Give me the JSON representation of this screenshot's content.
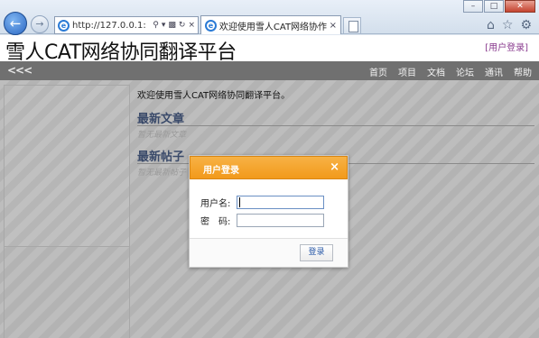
{
  "browser": {
    "window_buttons": {
      "minimize": "–",
      "maximize": "□",
      "close": "✕"
    },
    "address": "http://127.0.0.1:",
    "tab_title": "欢迎使用雪人CAT网络协作...",
    "tab_close": "×",
    "icons": [
      "back-arrow-icon",
      "forward-arrow-icon",
      "ie-logo-icon",
      "search-icon",
      "compat-icon",
      "refresh-icon",
      "stop-icon",
      "new-tab-icon",
      "home-icon",
      "favorites-star-icon",
      "settings-gear-icon"
    ]
  },
  "site": {
    "title": "雪人CAT网络协同翻译平台",
    "login_link": "[用户登录]",
    "nav_collapse": "<<<",
    "nav": [
      "首页",
      "项目",
      "文档",
      "论坛",
      "通讯",
      "帮助"
    ]
  },
  "content": {
    "welcome": "欢迎使用雪人CAT网络协同翻译平台。",
    "articles_title": "最新文章",
    "articles_empty": "暂无最新文章",
    "posts_title": "最新帖子",
    "posts_empty": "暂无最新帖子"
  },
  "modal": {
    "title": "用户登录",
    "close": "×",
    "username_label": "用户名:",
    "password_label": "密　码:",
    "username_value": "",
    "password_value": "",
    "submit": "登录"
  },
  "colors": {
    "navbar": "#707070",
    "modal_header": "#f29a1b",
    "login_link": "#8a3c8f",
    "section_title": "#3a4a6a"
  }
}
